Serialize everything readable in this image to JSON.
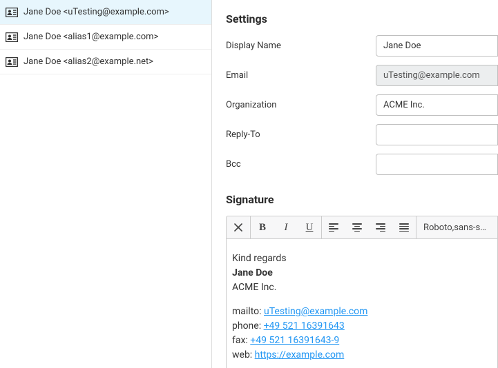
{
  "identities": [
    {
      "label": "Jane Doe <uTesting@example.com>",
      "selected": true
    },
    {
      "label": "Jane Doe <alias1@example.com>",
      "selected": false
    },
    {
      "label": "Jane Doe <alias2@example.net>",
      "selected": false
    }
  ],
  "settings": {
    "title": "Settings",
    "fields": {
      "displayName": {
        "label": "Display Name",
        "value": "Jane Doe"
      },
      "email": {
        "label": "Email",
        "value": "uTesting@example.com"
      },
      "organization": {
        "label": "Organization",
        "value": "ACME Inc."
      },
      "replyTo": {
        "label": "Reply-To",
        "value": ""
      },
      "bcc": {
        "label": "Bcc",
        "value": ""
      }
    }
  },
  "signature": {
    "title": "Signature",
    "toolbar": {
      "bold": "B",
      "italic": "I",
      "underline": "U",
      "fontSelect": "Roboto,sans-s…"
    },
    "body": {
      "greeting": "Kind regards",
      "name": "Jane Doe",
      "org": "ACME Inc.",
      "mailtoLabel": "mailto: ",
      "mailtoLink": "uTesting@example.com",
      "phoneLabel": "phone: ",
      "phoneLink": "+49 521 16391643",
      "faxLabel": "fax: ",
      "faxLink": "+49 521 16391643-9",
      "webLabel": "web: ",
      "webLink": "https://example.com"
    }
  }
}
